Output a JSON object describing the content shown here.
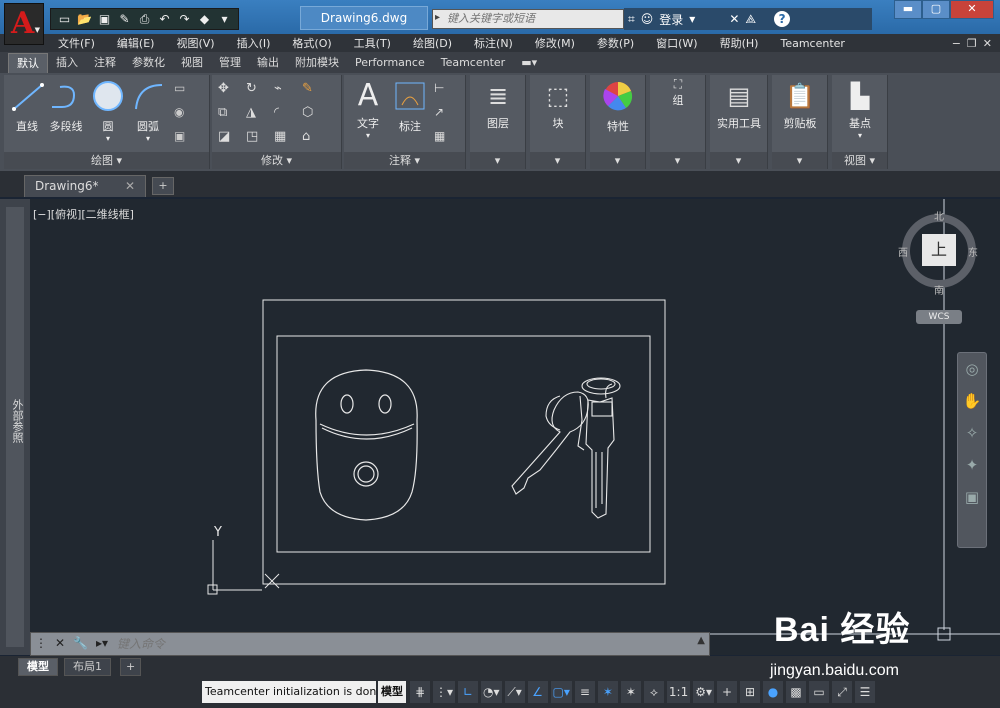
{
  "title_bar": {
    "file_title": "Drawing6.dwg",
    "search_placeholder": "键入关键字或短语",
    "login_label": "登录",
    "help_label": "?"
  },
  "menu": [
    "文件(F)",
    "编辑(E)",
    "视图(V)",
    "插入(I)",
    "格式(O)",
    "工具(T)",
    "绘图(D)",
    "标注(N)",
    "修改(M)",
    "参数(P)",
    "窗口(W)",
    "帮助(H)",
    "Teamcenter"
  ],
  "ribbon_tabs": [
    "默认",
    "插入",
    "注释",
    "参数化",
    "视图",
    "管理",
    "输出",
    "附加模块",
    "Performance",
    "Teamcenter"
  ],
  "active_tab": "默认",
  "ribbon": {
    "draw": {
      "panel_label": "绘图 ▾",
      "line": "直线",
      "polyline": "多段线",
      "circle": "圆",
      "arc": "圆弧"
    },
    "modify": {
      "panel_label": "修改 ▾"
    },
    "annotate": {
      "panel_label": "注释 ▾",
      "text": "文字",
      "dimension": "标注"
    },
    "layers": {
      "label": "图层"
    },
    "block": {
      "label": "块"
    },
    "properties": {
      "label": "特性"
    },
    "group": {
      "label": "组"
    },
    "utilities": {
      "label": "实用工具"
    },
    "clipboard": {
      "label": "剪贴板"
    },
    "view": {
      "base_label": "基点",
      "panel_label": "视图 ▾"
    }
  },
  "file_tab": {
    "label": "Drawing6*"
  },
  "viewport_label": "[−][俯视][二维线框]",
  "left_palette": "外部参照",
  "viewcube": {
    "north": "北",
    "south": "南",
    "east": "东",
    "west": "西",
    "face": "上",
    "wcs": "WCS"
  },
  "command_line": {
    "placeholder": "键入命令"
  },
  "layout_tabs": [
    "模型",
    "布局1"
  ],
  "status": {
    "message": "Teamcenter initialization is done",
    "model_label": "模型",
    "scale": "1:1"
  },
  "ucs": {
    "y_label": "Y",
    "x_label": "X"
  },
  "watermark": {
    "text": "Bai 经验",
    "url": "jingyan.baidu.com"
  },
  "colors": {
    "accent": "#d51b1b",
    "canvas": "#212830",
    "titlebar": "#2a6aa8"
  }
}
